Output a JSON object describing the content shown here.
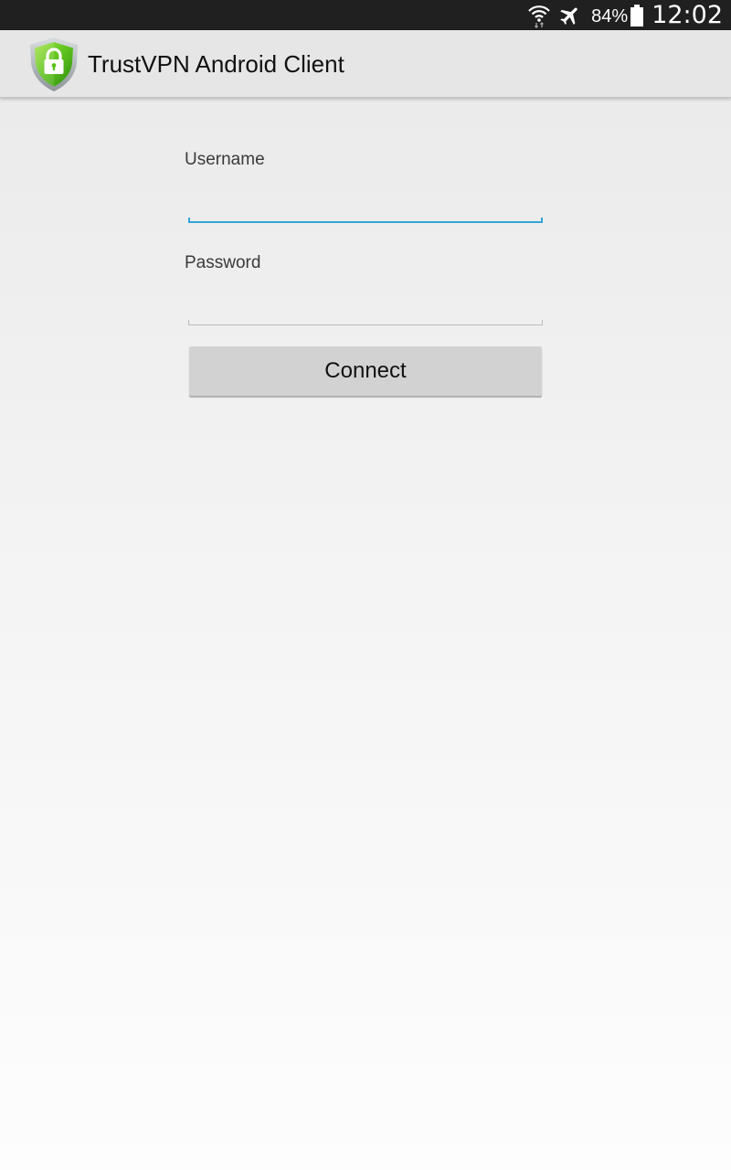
{
  "status_bar": {
    "battery_percent": "84%",
    "battery_level": 0.84,
    "time": "12:02",
    "icons": [
      "wifi-icon",
      "airplane-mode-icon",
      "battery-icon"
    ]
  },
  "action_bar": {
    "title": "TrustVPN Android Client",
    "logo_icon": "shield-lock-icon"
  },
  "form": {
    "username_label": "Username",
    "username_value": "",
    "password_label": "Password",
    "password_value": "",
    "connect_label": "Connect"
  },
  "colors": {
    "status_bar": "#202020",
    "action_bar": "#e6e6e6",
    "focus_accent": "#33a5d8",
    "button": "#d2d2d2",
    "logo_green": "#5cc21c"
  }
}
